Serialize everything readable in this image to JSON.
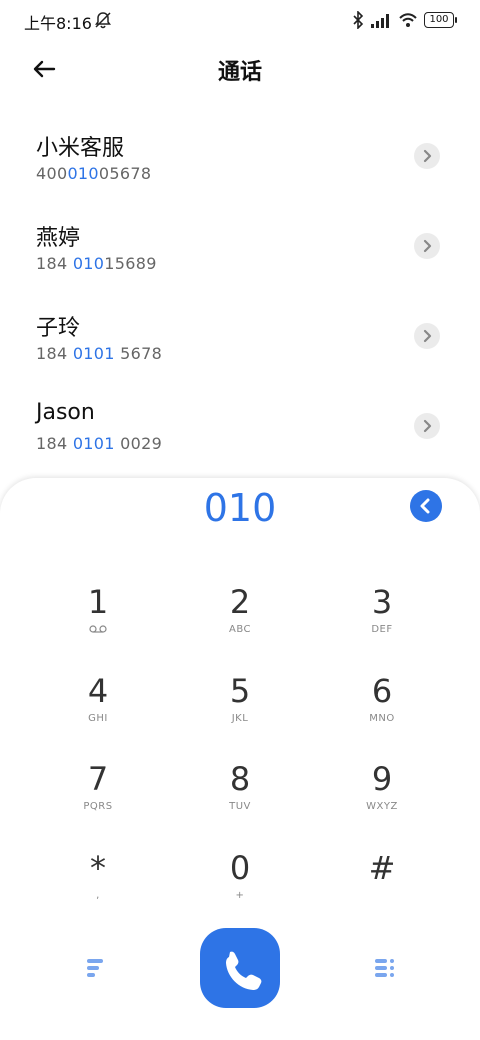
{
  "status": {
    "time": "上午8:16",
    "battery": "100"
  },
  "header": {
    "title": "通话"
  },
  "contacts": [
    {
      "name": "小米客服",
      "num_pre": "400",
      "num_hl": "010",
      "num_post": "05678"
    },
    {
      "name": "燕婷",
      "num_pre": "184 ",
      "num_hl": "010",
      "num_post": "15689"
    },
    {
      "name": "子玲",
      "num_pre": "184 ",
      "num_hl": "0101",
      "num_post": " 5678"
    },
    {
      "name": "Jason",
      "num_pre": "184 ",
      "num_hl": "0101",
      "num_post": " 0029"
    }
  ],
  "dialer": {
    "number": "010",
    "keys": [
      {
        "digit": "1",
        "letters": ""
      },
      {
        "digit": "2",
        "letters": "ABC"
      },
      {
        "digit": "3",
        "letters": "DEF"
      },
      {
        "digit": "4",
        "letters": "GHI"
      },
      {
        "digit": "5",
        "letters": "JKL"
      },
      {
        "digit": "6",
        "letters": "MNO"
      },
      {
        "digit": "7",
        "letters": "PQRS"
      },
      {
        "digit": "8",
        "letters": "TUV"
      },
      {
        "digit": "9",
        "letters": "WXYZ"
      },
      {
        "digit": "*",
        "letters": ","
      },
      {
        "digit": "0",
        "letters": "+"
      },
      {
        "digit": "#",
        "letters": ""
      }
    ]
  },
  "colors": {
    "accent": "#2e74e6"
  },
  "icons": [
    "bell-muted-icon",
    "bluetooth-icon",
    "signal-icon",
    "wifi-icon",
    "back-arrow-icon",
    "chevron-right-icon",
    "backspace-icon",
    "voicemail-icon",
    "menu-lines-icon",
    "phone-icon",
    "dialpad-list-icon"
  ]
}
